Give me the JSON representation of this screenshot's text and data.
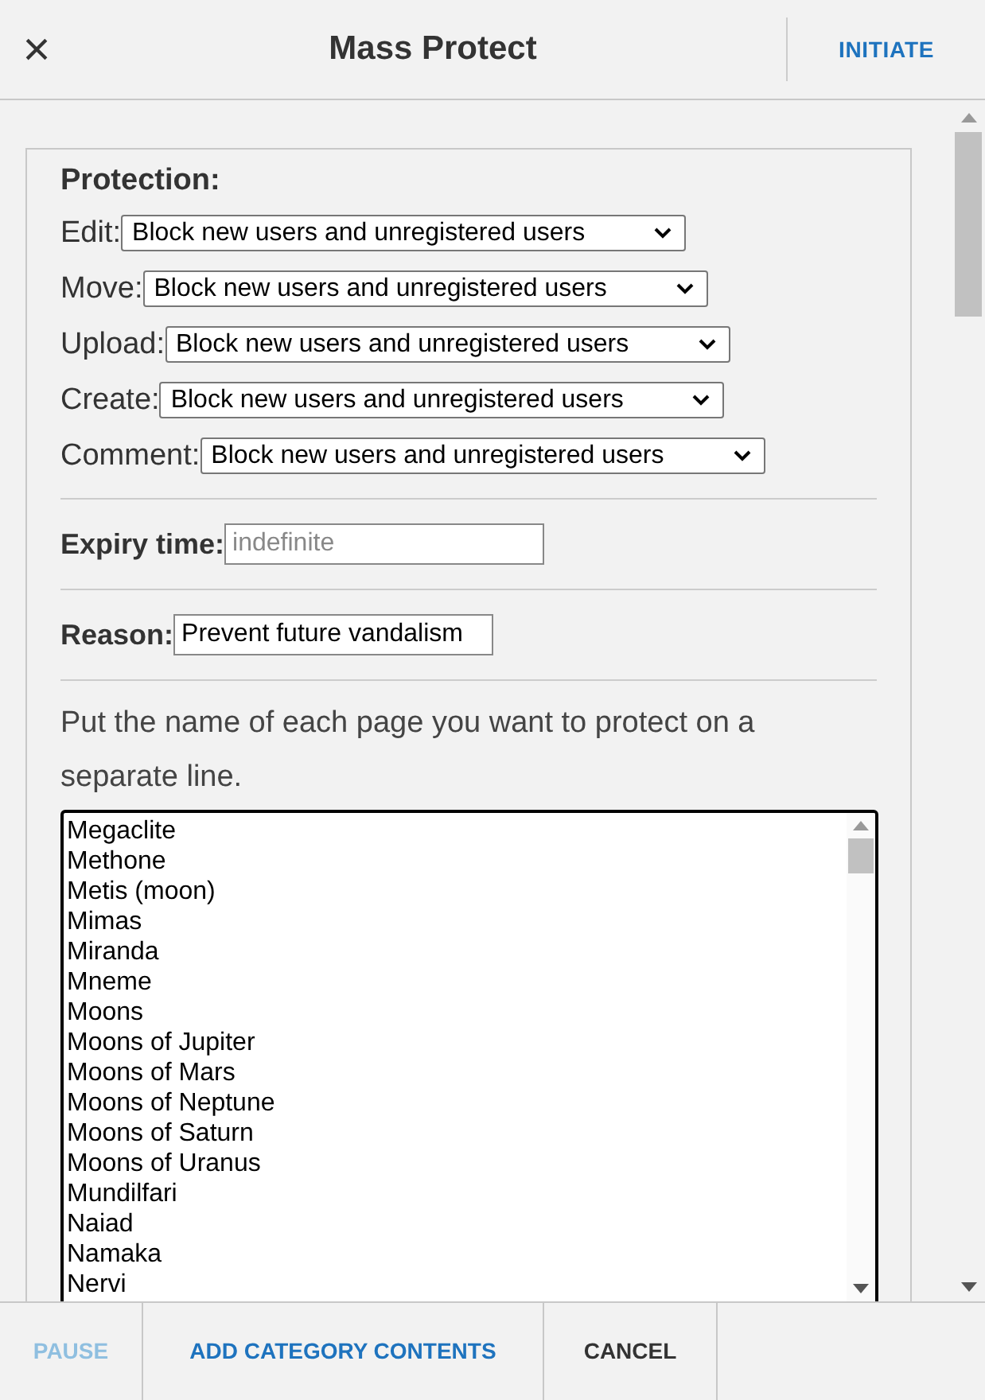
{
  "dialog": {
    "title": "Mass Protect",
    "close": "×",
    "primary_action": "INITIATE"
  },
  "protection": {
    "heading": "Protection:",
    "rows": [
      {
        "label": "Edit:",
        "value": "Block new users and unregistered users"
      },
      {
        "label": "Move:",
        "value": "Block new users and unregistered users"
      },
      {
        "label": "Upload:",
        "value": "Block new users and unregistered users"
      },
      {
        "label": "Create:",
        "value": "Block new users and unregistered users"
      },
      {
        "label": "Comment:",
        "value": "Block new users and unregistered users"
      }
    ]
  },
  "expiry": {
    "label": "Expiry time:",
    "placeholder": "indefinite"
  },
  "reason": {
    "label": "Reason:",
    "value": "Prevent future vandalism"
  },
  "instructions": "Put the name of each page you want to protect on a separate line.",
  "pages": [
    "Megaclite",
    "Methone",
    "Metis (moon)",
    "Mimas",
    "Miranda",
    "Mneme",
    "Moons",
    "Moons of Jupiter",
    "Moons of Mars",
    "Moons of Neptune",
    "Moons of Saturn",
    "Moons of Uranus",
    "Mundilfari",
    "Naiad",
    "Namaka",
    "Nervi"
  ],
  "footer": [
    {
      "label": "PAUSE",
      "disabled": true,
      "kind": "action"
    },
    {
      "label": "ADD CATEGORY CONTENTS",
      "disabled": false,
      "kind": "action"
    },
    {
      "label": "CANCEL",
      "disabled": false,
      "kind": "neutral"
    }
  ]
}
